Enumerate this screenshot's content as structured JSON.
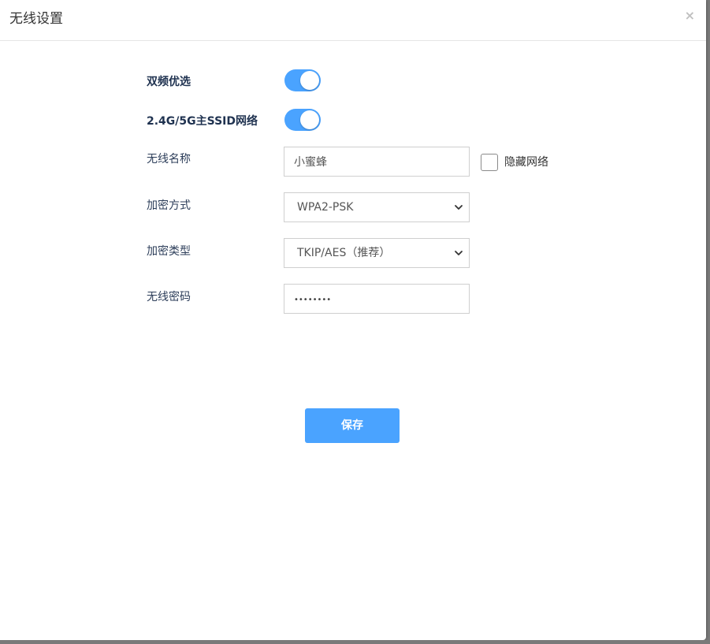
{
  "dialog": {
    "title": "无线设置",
    "close_label": "×"
  },
  "form": {
    "dual_band": {
      "label": "双频优选",
      "enabled": true
    },
    "main_ssid": {
      "label": "2.4G/5G主SSID网络",
      "enabled": true
    },
    "ssid": {
      "label": "无线名称",
      "value": "小蜜蜂"
    },
    "hide_network": {
      "label": "隐藏网络",
      "checked": false
    },
    "encryption_method": {
      "label": "加密方式",
      "value": "WPA2-PSK"
    },
    "encryption_type": {
      "label": "加密类型",
      "value": "TKIP/AES（推荐）"
    },
    "password": {
      "label": "无线密码",
      "value": "••••••••"
    }
  },
  "actions": {
    "save_label": "保存"
  },
  "colors": {
    "accent": "#4aa3ff",
    "label_text": "#2d3e5a",
    "border": "#cfcfcf"
  }
}
